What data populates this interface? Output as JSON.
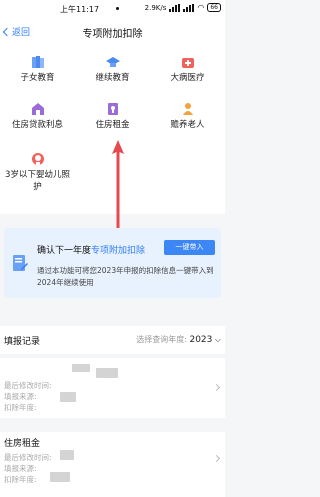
{
  "status_bar": {
    "time": "上午11:17",
    "network_speed": "2.9K/s",
    "battery": "66"
  },
  "nav": {
    "back_label": "返回",
    "title": "专项附加扣除"
  },
  "deduction_items": [
    {
      "label": "子女教育",
      "icon": "child-education-icon",
      "color": "#5b8ff6"
    },
    {
      "label": "继续教育",
      "icon": "graduation-cap-icon",
      "color": "#4c8af0"
    },
    {
      "label": "大病医疗",
      "icon": "medical-kit-icon",
      "color": "#f2605b"
    },
    {
      "label": "住房贷款利息",
      "icon": "house-loan-icon",
      "color": "#9b6cd6"
    },
    {
      "label": "住房租金",
      "icon": "house-rent-icon",
      "color": "#9b6cd6"
    },
    {
      "label": "赡养老人",
      "icon": "elder-support-icon",
      "color": "#f3a33b"
    },
    {
      "label": "3岁以下婴幼儿照护",
      "icon": "infant-care-icon",
      "color": "#f2605b"
    }
  ],
  "banner": {
    "heading_prefix": "确认下一年度",
    "heading_highlight": "专项附加扣除",
    "button_label": "一键带入",
    "description": "通过本功能可将您2023年申报的扣除信息一键带入到2024年继续使用"
  },
  "records": {
    "title": "填报记录",
    "filter_label": "选择查询年度:",
    "year": "2023",
    "items": [
      {
        "title": "",
        "last_modified_label": "最后修改时间:",
        "source_label": "填报来源:",
        "year_label": "扣除年度:"
      },
      {
        "title": "住房租金",
        "last_modified_label": "最后修改时间:",
        "source_label": "填报来源:",
        "year_label": "扣除年度:"
      }
    ]
  },
  "colors": {
    "accent": "#2f7df6",
    "arrow": "#e5484d",
    "banner_bg": "#e8f1fe"
  }
}
